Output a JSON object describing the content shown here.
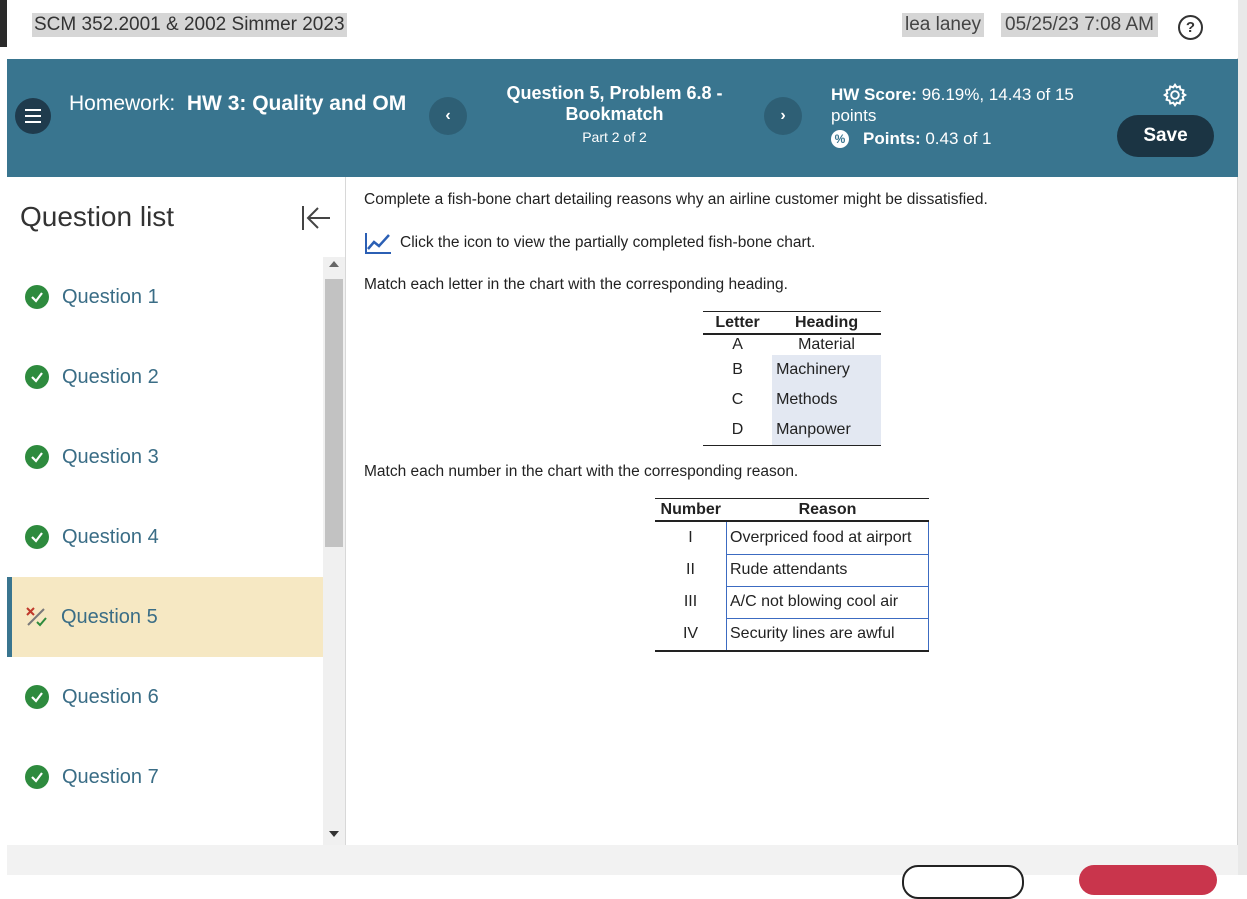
{
  "topbar": {
    "course_title": "SCM 352.2001 & 2002 Simmer 2023",
    "user_name": "lea laney",
    "datetime": "05/25/23 7:08 AM",
    "help_label": "?"
  },
  "header": {
    "homework_prefix": "Homework:",
    "homework_name": "HW 3: Quality and OM",
    "prev_label": "‹",
    "next_label": "›",
    "question_title": "Question 5, Problem 6.8 - Bookmatch",
    "question_part": "Part 2 of 2",
    "score_label": "HW Score:",
    "score_value": "96.19%, 14.43 of 15 points",
    "points_label": "Points:",
    "points_value": "0.43 of 1",
    "save_label": "Save"
  },
  "sidebar": {
    "title": "Question list",
    "items": [
      {
        "label": "Question 1",
        "status": "complete"
      },
      {
        "label": "Question 2",
        "status": "complete"
      },
      {
        "label": "Question 3",
        "status": "complete"
      },
      {
        "label": "Question 4",
        "status": "complete"
      },
      {
        "label": "Question 5",
        "status": "partial"
      },
      {
        "label": "Question 6",
        "status": "complete"
      },
      {
        "label": "Question 7",
        "status": "complete"
      }
    ]
  },
  "main": {
    "prompt": "Complete a fish-bone chart detailing reasons why an airline customer might be dissatisfied.",
    "chart_link": "Click the icon to view the partially completed fish-bone chart.",
    "instruction_letters": "Match each letter in the chart with the corresponding heading.",
    "instruction_numbers": "Match each number in the chart with the corresponding reason.",
    "letter_table": {
      "headers": [
        "Letter",
        "Heading"
      ],
      "rows": [
        {
          "letter": "A",
          "heading": "Material"
        },
        {
          "letter": "B",
          "heading": "Machinery"
        },
        {
          "letter": "C",
          "heading": "Methods"
        },
        {
          "letter": "D",
          "heading": "Manpower"
        }
      ]
    },
    "number_table": {
      "headers": [
        "Number",
        "Reason"
      ],
      "rows": [
        {
          "number": "I",
          "reason": "Overpriced food at airport"
        },
        {
          "number": "II",
          "reason": "Rude attendants"
        },
        {
          "number": "III",
          "reason": "A/C not blowing cool air"
        },
        {
          "number": "IV",
          "reason": "Security lines are awful"
        }
      ]
    }
  },
  "colors": {
    "header_bg": "#39758f",
    "save_bg": "#1b3443",
    "active_item_bg": "#f6e8c3",
    "check_green": "#2e8b3e"
  }
}
